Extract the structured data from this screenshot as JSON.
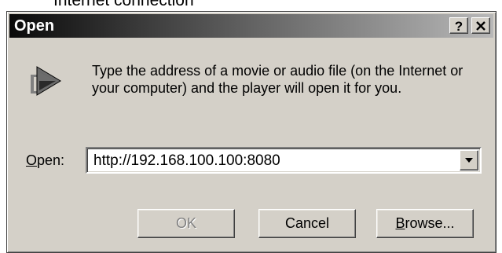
{
  "background_text": "Internet connection",
  "dialog": {
    "title": "Open",
    "help_label": "?",
    "close_label": "✕",
    "description": "Type the address of a movie or audio file (on the Internet or your computer) and the player will open it for you.",
    "open_label_access": "O",
    "open_label_rest": "pen:",
    "open_value": "http://192.168.100.100:8080",
    "buttons": {
      "ok": "OK",
      "cancel": "Cancel",
      "browse_access": "B",
      "browse_rest": "rowse..."
    }
  },
  "icons": {
    "app": "media-player-icon",
    "dropdown": "chevron-down-icon"
  }
}
